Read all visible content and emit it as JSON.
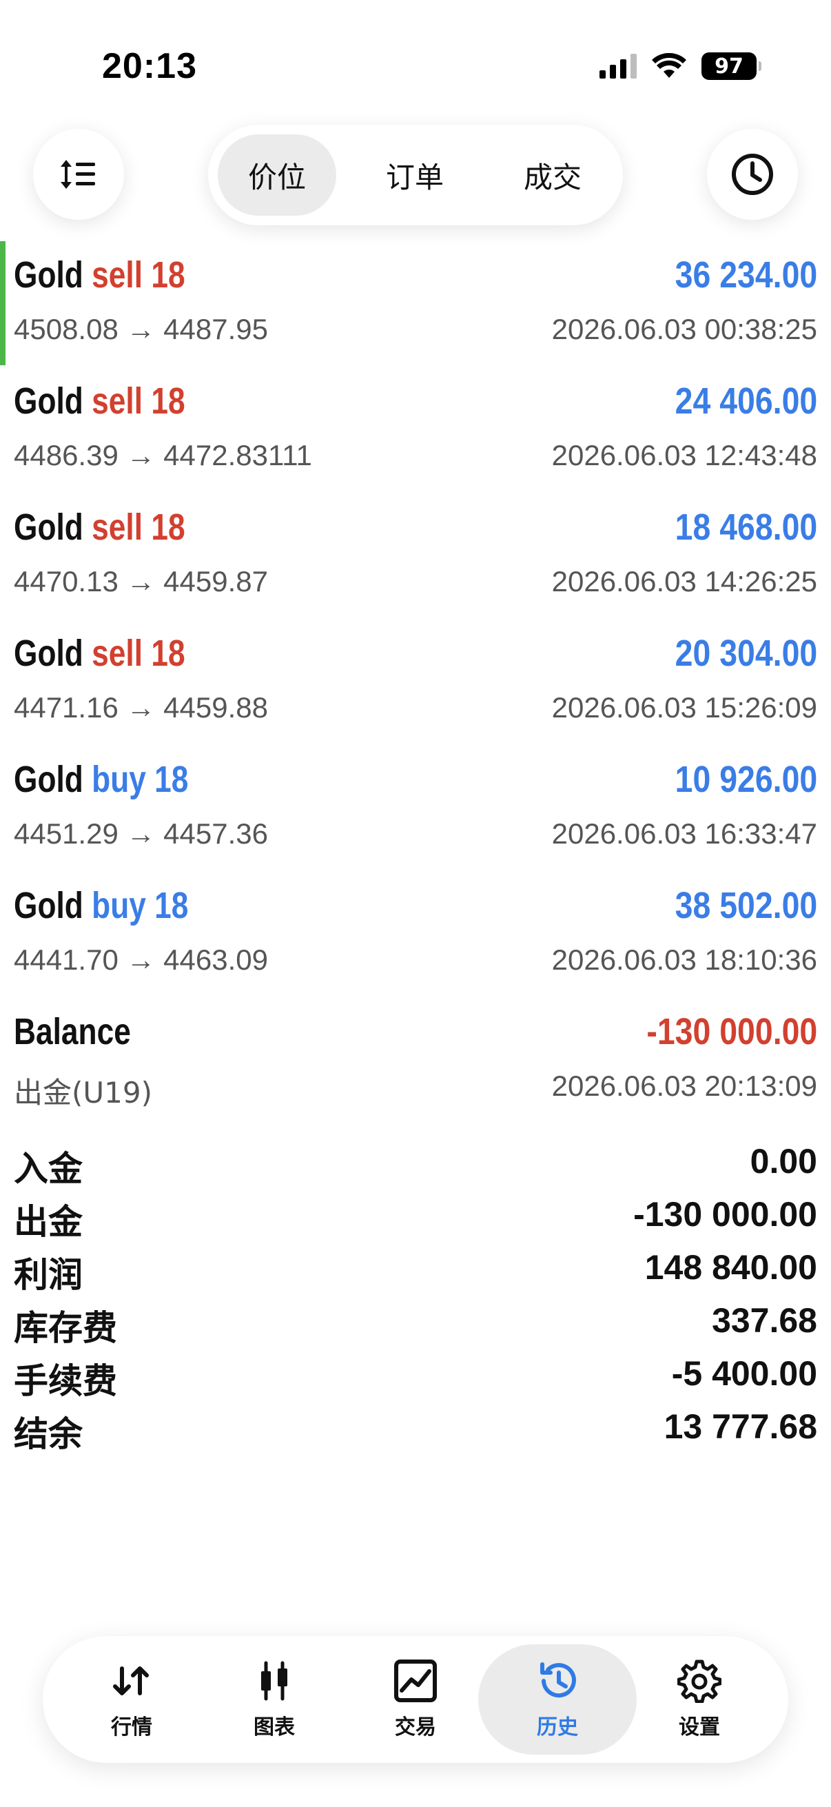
{
  "status_bar": {
    "time": "20:13",
    "battery": "97"
  },
  "toolbar": {
    "segments": [
      {
        "label": "价位",
        "active": true
      },
      {
        "label": "订单",
        "active": false
      },
      {
        "label": "成交",
        "active": false
      }
    ]
  },
  "colors": {
    "sell": "#d2402f",
    "buy": "#3a7de6",
    "profit_positive": "#3a7de6",
    "profit_negative": "#d2402f",
    "selected_marker": "#4cb648",
    "active_tab": "#2f7ae5"
  },
  "deals": [
    {
      "symbol": "Gold",
      "side": "sell 18",
      "type": "sell",
      "profit": "36 234.00",
      "prices": "4508.08 → 4487.95",
      "time": "2026.06.03 00:38:25"
    },
    {
      "symbol": "Gold",
      "side": "sell 18",
      "type": "sell",
      "profit": "24 406.00",
      "prices": "4486.39 → 4472.83111",
      "time": "2026.06.03 12:43:48"
    },
    {
      "symbol": "Gold",
      "side": "sell 18",
      "type": "sell",
      "profit": "18 468.00",
      "prices": "4470.13 → 4459.87",
      "time": "2026.06.03 14:26:25"
    },
    {
      "symbol": "Gold",
      "side": "sell 18",
      "type": "sell",
      "profit": "20 304.00",
      "prices": "4471.16 → 4459.88",
      "time": "2026.06.03 15:26:09"
    },
    {
      "symbol": "Gold",
      "side": "buy 18",
      "type": "buy",
      "profit": "10 926.00",
      "prices": "4451.29 → 4457.36",
      "time": "2026.06.03 16:33:47"
    },
    {
      "symbol": "Gold",
      "side": "buy 18",
      "type": "buy",
      "profit": "38 502.00",
      "prices": "4441.70 → 4463.09",
      "time": "2026.06.03 18:10:36"
    }
  ],
  "balance_entry": {
    "title": "Balance",
    "amount": "-130 000.00",
    "comment": "出金(U19)",
    "time": "2026.06.03 20:13:09"
  },
  "summary": [
    {
      "label": "入金",
      "value": "0.00"
    },
    {
      "label": "出金",
      "value": "-130 000.00"
    },
    {
      "label": "利润",
      "value": "148 840.00"
    },
    {
      "label": "库存费",
      "value": "337.68"
    },
    {
      "label": "手续费",
      "value": "-5 400.00"
    },
    {
      "label": "结余",
      "value": "13 777.68"
    }
  ],
  "tab_bar": {
    "quotes": {
      "label": "行情",
      "icon": "arrows-updown-icon"
    },
    "charts": {
      "label": "图表",
      "icon": "candlestick-icon"
    },
    "trade": {
      "label": "交易",
      "icon": "trade-chart-icon"
    },
    "history": {
      "label": "历史",
      "icon": "history-icon",
      "active": true
    },
    "settings": {
      "label": "设置",
      "icon": "gear-icon"
    }
  }
}
